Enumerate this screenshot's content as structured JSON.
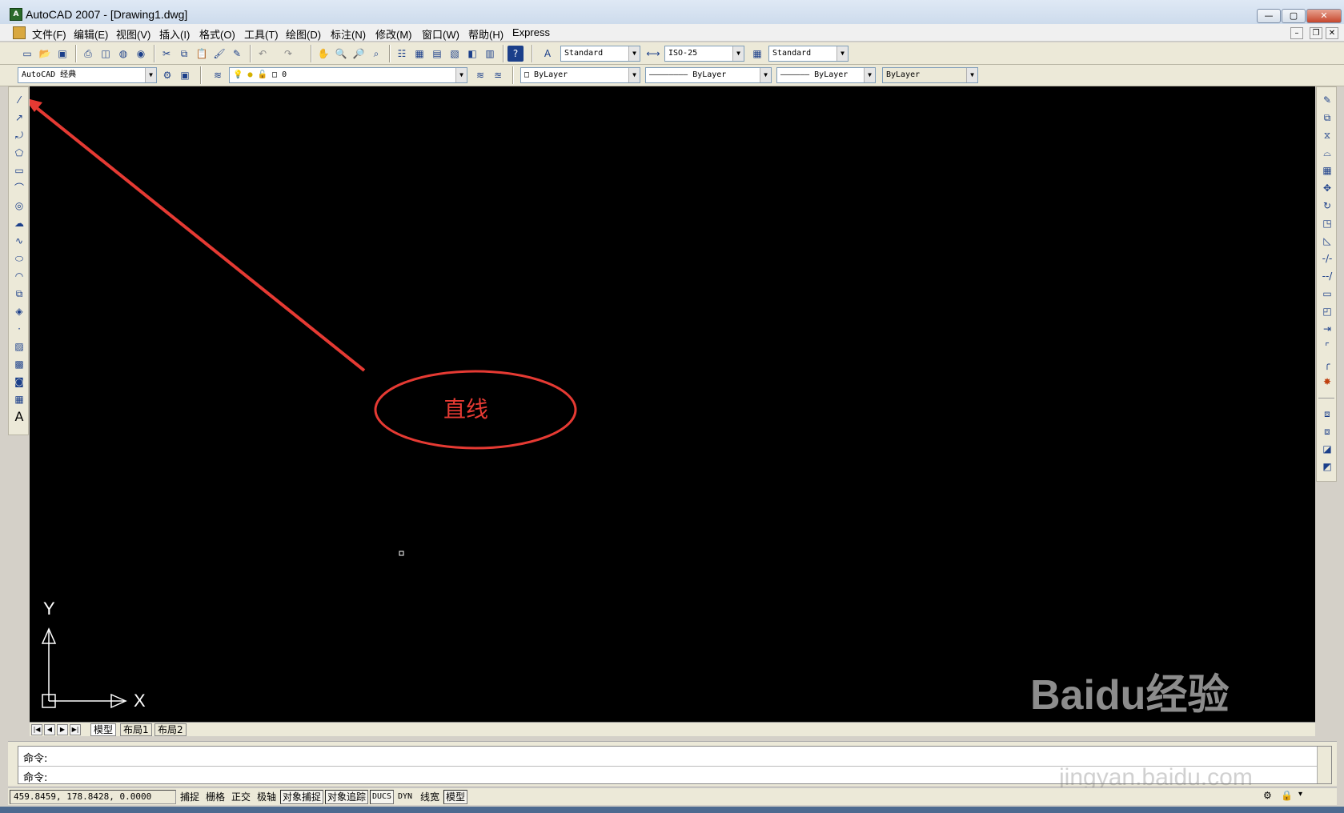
{
  "window": {
    "title": "AutoCAD 2007 - [Drawing1.dwg]",
    "app_icon": "A",
    "min": "—",
    "max": "▢",
    "close": "✕",
    "mdi_min": "–",
    "mdi_restore": "❐",
    "mdi_close": "✕"
  },
  "menu": [
    "文件(F)",
    "编辑(E)",
    "视图(V)",
    "插入(I)",
    "格式(O)",
    "工具(T)",
    "绘图(D)",
    "标注(N)",
    "修改(M)",
    "窗口(W)",
    "帮助(H)",
    "Express"
  ],
  "styles": {
    "text_style": "Standard",
    "dim_style": "ISO-25",
    "table_style": "Standard"
  },
  "workspace": "AutoCAD 经典",
  "layer": "0",
  "properties": {
    "color": "ByLayer",
    "linetype": "ByLayer",
    "lineweight": "ByLayer",
    "plotstyle": "ByLayer"
  },
  "annotation": {
    "label": "直线",
    "color": "#e53a33"
  },
  "ucs": {
    "x": "X",
    "y": "Y"
  },
  "tabs": [
    "模型",
    "布局1",
    "布局2"
  ],
  "command": {
    "line1": "命令:",
    "line2": "命令:"
  },
  "status": {
    "coords": "459.8459,  178.8428, 0.0000",
    "buttons": [
      "捕捉",
      "栅格",
      "正交",
      "极轴",
      "对象捕捉",
      "对象追踪",
      "DUCS",
      "DYN",
      "线宽",
      "模型"
    ]
  },
  "watermark": {
    "brand": "Baidu经验",
    "url": "jingyan.baidu.com"
  },
  "icons": {
    "left_tools": [
      "line-icon",
      "construction-line-icon",
      "polyline-icon",
      "polygon-icon",
      "rectangle-icon",
      "arc-icon",
      "circle-icon",
      "revision-cloud-icon",
      "spline-icon",
      "ellipse-icon",
      "ellipse-arc-icon",
      "insert-block-icon",
      "make-block-icon",
      "point-icon",
      "hatch-icon",
      "gradient-icon",
      "region-icon",
      "table-icon",
      "multiline-text-icon"
    ]
  }
}
